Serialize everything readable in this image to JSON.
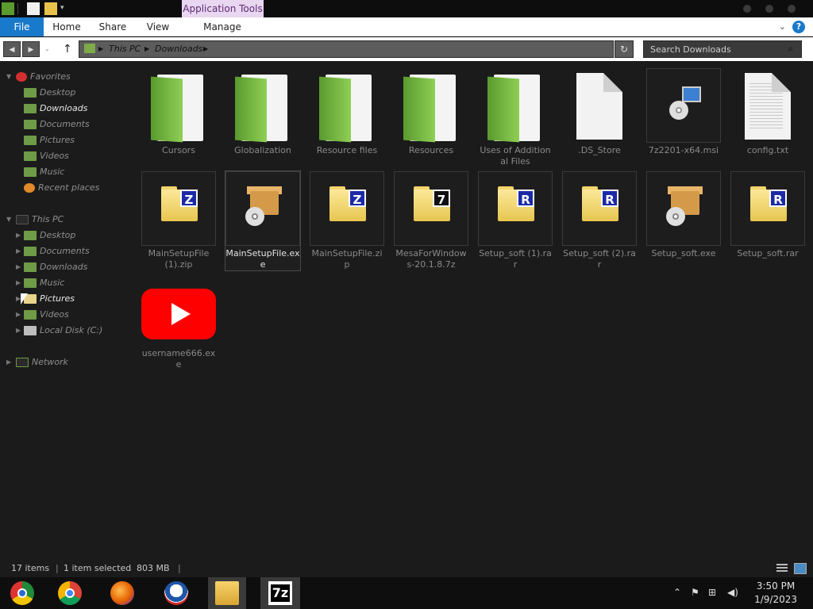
{
  "ribbon": {
    "contextual": "Application Tools",
    "tabs": [
      "File",
      "Home",
      "Share",
      "View",
      "Manage"
    ],
    "help": "?"
  },
  "address": {
    "crumbs": [
      "This PC",
      "Downloads"
    ],
    "search_placeholder": "Search Downloads"
  },
  "navpane": {
    "favorites": "Favorites",
    "fav_items": [
      "Desktop",
      "Downloads",
      "Documents",
      "Pictures",
      "Videos",
      "Music",
      "Recent places"
    ],
    "this_pc": "This PC",
    "pc_items": [
      "Desktop",
      "Documents",
      "Downloads",
      "Music",
      "Pictures",
      "Videos",
      "Local Disk (C:)"
    ],
    "network": "Network"
  },
  "files": [
    {
      "name": "Cursors",
      "type": "folder"
    },
    {
      "name": "Globalization",
      "type": "folder"
    },
    {
      "name": "Resource files",
      "type": "folder"
    },
    {
      "name": "Resources",
      "type": "folder"
    },
    {
      "name": "Uses of Additional Files",
      "type": "folder"
    },
    {
      "name": ".DS_Store",
      "type": "blank"
    },
    {
      "name": "7z2201-x64.msi",
      "type": "msi"
    },
    {
      "name": "config.txt",
      "type": "text"
    },
    {
      "name": "MainSetupFile (1).zip",
      "type": "zip",
      "badge": "Z"
    },
    {
      "name": "MainSetupFile.exe",
      "type": "setup"
    },
    {
      "name": "MainSetupFile.zip",
      "type": "zip",
      "badge": "Z"
    },
    {
      "name": "MesaForWindows-20.1.8.7z",
      "type": "7z",
      "badge": "7"
    },
    {
      "name": "Setup_soft (1).rar",
      "type": "rar",
      "badge": "R"
    },
    {
      "name": "Setup_soft (2).rar",
      "type": "rar",
      "badge": "R"
    },
    {
      "name": "Setup_soft.exe",
      "type": "setup"
    },
    {
      "name": "Setup_soft.rar",
      "type": "rar",
      "badge": "R"
    },
    {
      "name": "username666.exe",
      "type": "youtube"
    }
  ],
  "status": {
    "count": "17 items",
    "selection": "1 item selected",
    "size": "803 MB"
  },
  "taskbar": {
    "time": "3:50 PM",
    "date": "1/9/2023",
    "apps": [
      "chromium-icon",
      "chrome-icon",
      "firefox-icon",
      "obama-icon",
      "file-explorer-icon",
      "7zip-icon"
    ],
    "seven_zip_label": "7z"
  }
}
